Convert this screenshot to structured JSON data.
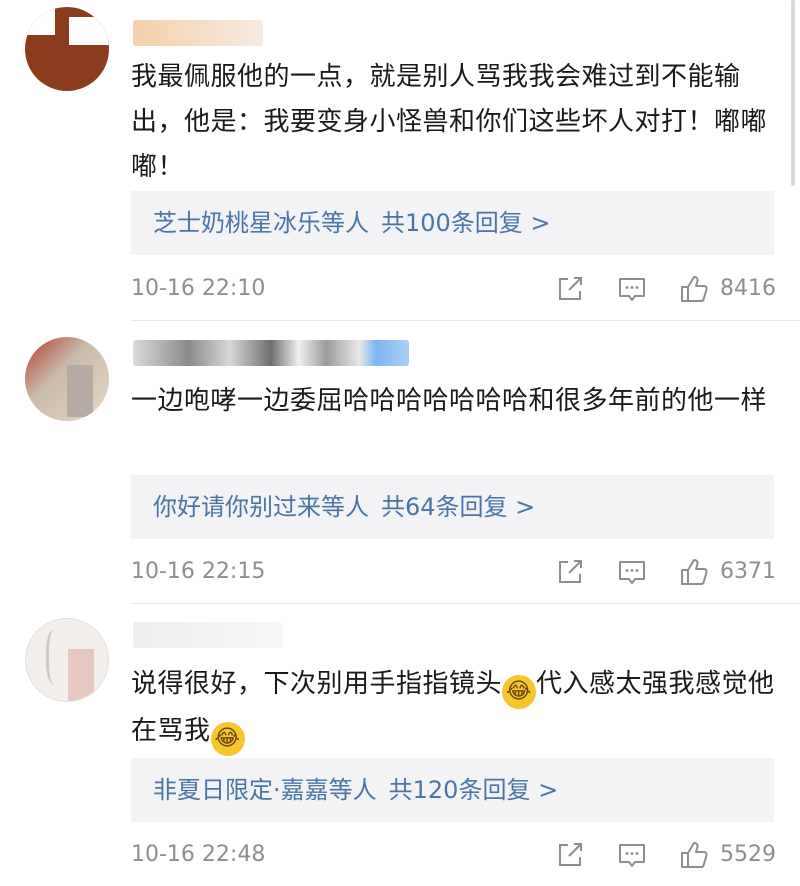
{
  "comments": [
    {
      "text": "我最佩服他的一点，就是别人骂我我会难过到不能输出，他是：我要变身小怪兽和你们这些坏人对打！嘟嘟嘟！",
      "reply_names": "芝士奶桃星冰乐等人",
      "reply_count": "共100条回复 >",
      "time": "10-16 22:10",
      "likes": "8416"
    },
    {
      "text": "一边咆哮一边委屈哈哈哈哈哈哈哈和很多年前的他一样",
      "reply_names": "你好请你别过来等人",
      "reply_count": "共64条回复 >",
      "time": "10-16 22:15",
      "likes": "6371"
    },
    {
      "text_part1": "说得很好，下次别用手指指镜头",
      "text_part2": "代入感太强我感觉他在骂我",
      "emoji": "😂",
      "reply_names": "非夏日限定·嘉嘉等人",
      "reply_count": "共120条回复 >",
      "time": "10-16 22:48",
      "likes": "5529"
    }
  ],
  "icons": {
    "share": "share-icon",
    "comment": "comment-icon",
    "like": "thumbs-up-icon"
  },
  "colors": {
    "reply_link": "#4a75a6",
    "meta_gray": "#8e8e8e",
    "reply_bg": "#f3f3f5"
  }
}
